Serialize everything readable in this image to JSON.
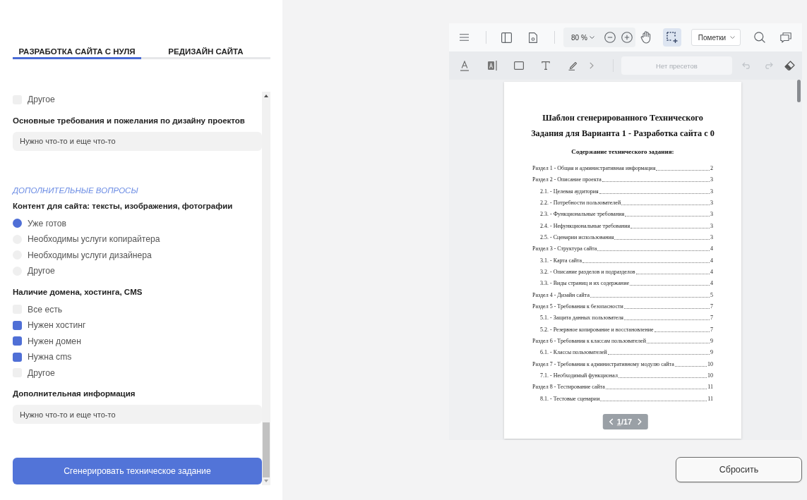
{
  "tabs": [
    {
      "label": "РАЗРАБОТКА САЙТА С НУЛЯ",
      "selected": true
    },
    {
      "label": "РЕДИЗАЙН САЙТА",
      "selected": false
    }
  ],
  "form": {
    "items": [
      {
        "kind": "checkbox",
        "label": "Другое",
        "checked": false
      },
      {
        "kind": "question",
        "label": "Основные требования и пожелания по дизайну проектов"
      },
      {
        "kind": "field",
        "value": "Нужно что-то и еще что-то"
      },
      {
        "kind": "section",
        "label": "ДОПОЛНИТЕЛЬНЫЕ ВОПРОСЫ"
      },
      {
        "kind": "question",
        "label": "Контент для сайта: тексты, изображения, фотографии"
      },
      {
        "kind": "radio",
        "label": "Уже готов",
        "selected": true
      },
      {
        "kind": "radio",
        "label": "Необходимы услуги копирайтера",
        "selected": false
      },
      {
        "kind": "radio",
        "label": "Необходимы услуги дизайнера",
        "selected": false
      },
      {
        "kind": "radio",
        "label": "Другое",
        "selected": false
      },
      {
        "kind": "question",
        "label": "Наличие домена, хостинга, CMS"
      },
      {
        "kind": "checkbox",
        "label": "Все есть",
        "checked": false
      },
      {
        "kind": "checkbox",
        "label": "Нужен хостинг",
        "checked": true
      },
      {
        "kind": "checkbox",
        "label": "Нужен домен",
        "checked": true
      },
      {
        "kind": "checkbox",
        "label": "Нужна cms",
        "checked": true
      },
      {
        "kind": "checkbox",
        "label": "Другое",
        "checked": false
      },
      {
        "kind": "question",
        "label": "Дополнительная информация"
      },
      {
        "kind": "field",
        "value": "Нужно что-то и еще что-то"
      }
    ],
    "submit_button": "Сгенерировать техническое задание"
  },
  "viewer": {
    "toolbar": {
      "zoom": "80 %",
      "tools": [
        {
          "kind": "pan",
          "selected": false
        },
        {
          "kind": "select",
          "selected": true
        }
      ],
      "mode_dropdown": "Пометки"
    },
    "annotation_bar": {
      "presets_field": {
        "placeholder": "Нет пресетов"
      },
      "undo": {
        "disabled": true
      },
      "redo": {
        "disabled": true
      }
    },
    "document": {
      "title": "Шаблон сгенерированного Технического Задания для Варианта 1 - Разработка сайта с 0",
      "subtitle": "Содержание технического задания:",
      "toc": [
        {
          "title": "Раздел 1 - Общая и административная информация",
          "page": "2"
        },
        {
          "title": "Раздел 2 - Описание проекта",
          "page": "3",
          "children": [
            {
              "title": "2.1. - Целевая аудитория",
              "page": "3"
            },
            {
              "title": "2.2. - Потребности пользователей",
              "page": "3"
            },
            {
              "title": "2.3. - Функциональные требования",
              "page": "3"
            },
            {
              "title": "2.4. - Нефункциональные требования",
              "page": "3"
            },
            {
              "title": "2.5. - Сценарии использования",
              "page": "3"
            }
          ]
        },
        {
          "title": "Раздел 3 - Структура сайта",
          "page": "4",
          "children": [
            {
              "title": "3.1. - Карта сайта",
              "page": "4"
            },
            {
              "title": "3.2. - Описание разделов и подразделов",
              "page": "4"
            },
            {
              "title": "3.3. - Виды страниц и их содержание",
              "page": "4"
            }
          ]
        },
        {
          "title": "Раздел 4 - Дизайн сайта",
          "page": "5"
        },
        {
          "title": "Раздел 5 - Требования к безопасности",
          "page": "7",
          "children": [
            {
              "title": "5.1. - Защита данных пользователя",
              "page": "7"
            },
            {
              "title": "5.2. - Резервное копирование и восстановление",
              "page": "7"
            }
          ]
        },
        {
          "title": "Раздел 6 - Требования к классам пользователей",
          "page": "9",
          "children": [
            {
              "title": "6.1. - Классы пользователей",
              "page": "9"
            }
          ]
        },
        {
          "title": "Раздел 7 - Требования к административному модулю сайта",
          "page": "10",
          "children": [
            {
              "title": "7.1. - Необходимый функционал",
              "page": "10"
            }
          ]
        },
        {
          "title": "Раздел 8 - Тестирование сайта",
          "page": "11",
          "children": [
            {
              "title": "8.1. - Тестовые сценарии",
              "page": "11"
            }
          ]
        }
      ]
    },
    "pager": {
      "current": "1",
      "total": "/17"
    }
  },
  "reset_button": "Сбросить"
}
